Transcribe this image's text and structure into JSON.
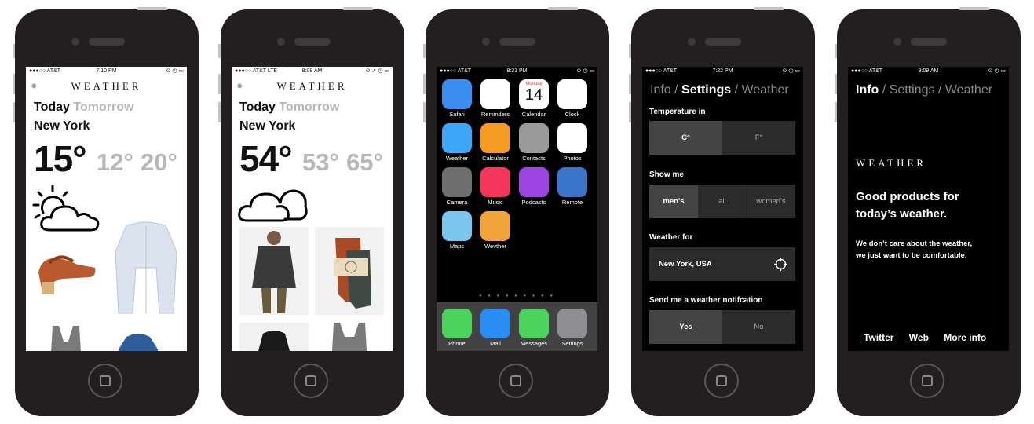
{
  "phones": [
    {
      "status": {
        "carrier": "●●●○○ AT&T",
        "time": "7:10 PM",
        "right": "⊙ ◷ ▭"
      },
      "logo": "WEATHER",
      "tab_active": "Today",
      "tab_inactive": "Tomorrow",
      "city": "New York",
      "temp_now": "15°",
      "temp_low": "12°",
      "temp_high": "20°"
    },
    {
      "status": {
        "carrier": "●●●○○ AT&T LTE",
        "time": "9:08 AM",
        "right": "⊙ ➚ ◷ ▭"
      },
      "logo": "WEATHER",
      "tab_active": "Today",
      "tab_inactive": "Tomorrow",
      "city": "New York",
      "temp_now": "54°",
      "temp_low": "53°",
      "temp_high": "65°"
    },
    {
      "status": {
        "carrier": "●●●○○ AT&T",
        "time": "8:31 PM",
        "right": "⊙ ◷ ▭"
      },
      "apps": [
        {
          "label": "Safari",
          "color": "#3b8df0"
        },
        {
          "label": "Reminders",
          "color": "#ffffff"
        },
        {
          "label": "Calendar",
          "color": "#ffffff"
        },
        {
          "label": "Clock",
          "color": "#ffffff"
        },
        {
          "label": "Weather",
          "color": "#3ba7f5"
        },
        {
          "label": "Calculator",
          "color": "#f59a23"
        },
        {
          "label": "Contacts",
          "color": "#9a9a9a"
        },
        {
          "label": "Photos",
          "color": "#ffffff"
        },
        {
          "label": "Camera",
          "color": "#6e6e6e"
        },
        {
          "label": "Music",
          "color": "#f5365c"
        },
        {
          "label": "Podcasts",
          "color": "#9d45e0"
        },
        {
          "label": "Remote",
          "color": "#3a74c8"
        },
        {
          "label": "Maps",
          "color": "#7bc6ef"
        },
        {
          "label": "Wevther",
          "color": "#f2a33a"
        }
      ],
      "calendar_day": "Monday",
      "calendar_date": "14",
      "dock": [
        {
          "label": "Phone",
          "color": "#4cd35e"
        },
        {
          "label": "Mail",
          "color": "#2a8df5"
        },
        {
          "label": "Messages",
          "color": "#4cd35e"
        },
        {
          "label": "Settings",
          "color": "#8e8e93"
        }
      ]
    },
    {
      "status": {
        "carrier": "●●●○○ AT&T",
        "time": "7:22 PM",
        "right": "⊙ ◷ ▭"
      },
      "nav": {
        "info": "Info",
        "settings": "Settings",
        "weather": "Weather",
        "sep": "/"
      },
      "temp_label": "Temperature in",
      "temp_opts": [
        "C°",
        "F°"
      ],
      "show_label": "Show me",
      "show_opts": [
        "men's",
        "all",
        "women's"
      ],
      "for_label": "Weather for",
      "location": "New York, USA",
      "notify_label": "Send me a weather notifcation",
      "notify_opts": [
        "Yes",
        "No"
      ]
    },
    {
      "status": {
        "carrier": "●●●○○ AT&T",
        "time": "9:09 AM",
        "right": "⊙ ◷ ▭"
      },
      "nav": {
        "info": "Info",
        "settings": "Settings",
        "weather": "Weather",
        "sep": "/"
      },
      "logo": "WEATHER",
      "headline": "Good products for today’s weather.",
      "body_1": "We don’t care about the weather,",
      "body_2": "we just want to be comfortable.",
      "links": [
        "Twitter",
        "Web",
        "More info"
      ]
    }
  ]
}
